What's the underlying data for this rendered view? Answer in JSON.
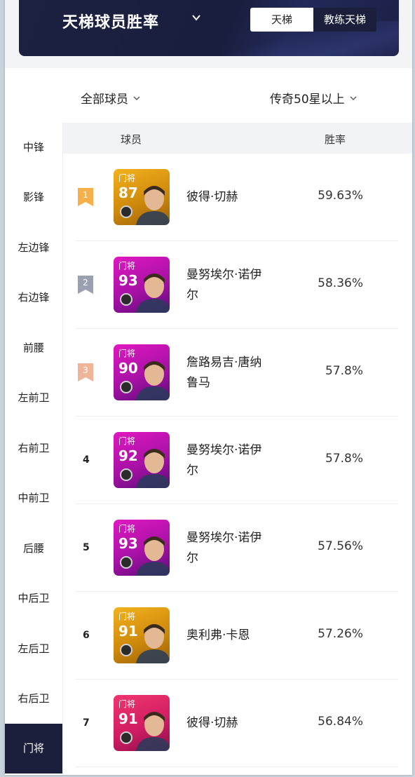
{
  "header": {
    "title": "天梯球员胜率",
    "tabs": [
      {
        "label": "天梯",
        "active": true
      },
      {
        "label": "教练天梯",
        "active": false
      }
    ]
  },
  "filters": {
    "player_filter": "全部球员",
    "star_filter": "传奇50星以上"
  },
  "sidebar": {
    "items": [
      {
        "label": "中锋"
      },
      {
        "label": "影锋"
      },
      {
        "label": "左边锋"
      },
      {
        "label": "右边锋"
      },
      {
        "label": "前腰"
      },
      {
        "label": "左前卫"
      },
      {
        "label": "右前卫"
      },
      {
        "label": "中前卫"
      },
      {
        "label": "后腰"
      },
      {
        "label": "中后卫"
      },
      {
        "label": "左后卫"
      },
      {
        "label": "右后卫"
      },
      {
        "label": "门将",
        "active": true
      }
    ]
  },
  "table": {
    "col_player": "球员",
    "col_rate": "胜率",
    "rows": [
      {
        "rank": "1",
        "ribbon_color": "#f5b04a",
        "position": "门将",
        "rating": "87",
        "card_style": "gold",
        "name_line1": "彼得·切赫",
        "name_line2": "",
        "rate": "59.63%"
      },
      {
        "rank": "2",
        "ribbon_color": "#9aa0b0",
        "position": "门将",
        "rating": "93",
        "card_style": "purple",
        "name_line1": "曼努埃尔·诺伊",
        "name_line2": "尔",
        "rate": "58.36%"
      },
      {
        "rank": "3",
        "ribbon_color": "#efb59a",
        "position": "门将",
        "rating": "90",
        "card_style": "purple",
        "name_line1": "詹路易吉·唐纳",
        "name_line2": "鲁马",
        "rate": "57.8%"
      },
      {
        "rank": "4",
        "ribbon_color": "",
        "position": "门将",
        "rating": "92",
        "card_style": "purple",
        "name_line1": "曼努埃尔·诺伊",
        "name_line2": "尔",
        "rate": "57.8%"
      },
      {
        "rank": "5",
        "ribbon_color": "",
        "position": "门将",
        "rating": "93",
        "card_style": "purple",
        "name_line1": "曼努埃尔·诺伊",
        "name_line2": "尔",
        "rate": "57.56%"
      },
      {
        "rank": "6",
        "ribbon_color": "",
        "position": "门将",
        "rating": "91",
        "card_style": "gold",
        "name_line1": "奥利弗·卡恩",
        "name_line2": "",
        "rate": "57.26%"
      },
      {
        "rank": "7",
        "ribbon_color": "",
        "position": "门将",
        "rating": "91",
        "card_style": "pink",
        "name_line1": "彼得·切赫",
        "name_line2": "",
        "rate": "56.84%"
      }
    ]
  }
}
